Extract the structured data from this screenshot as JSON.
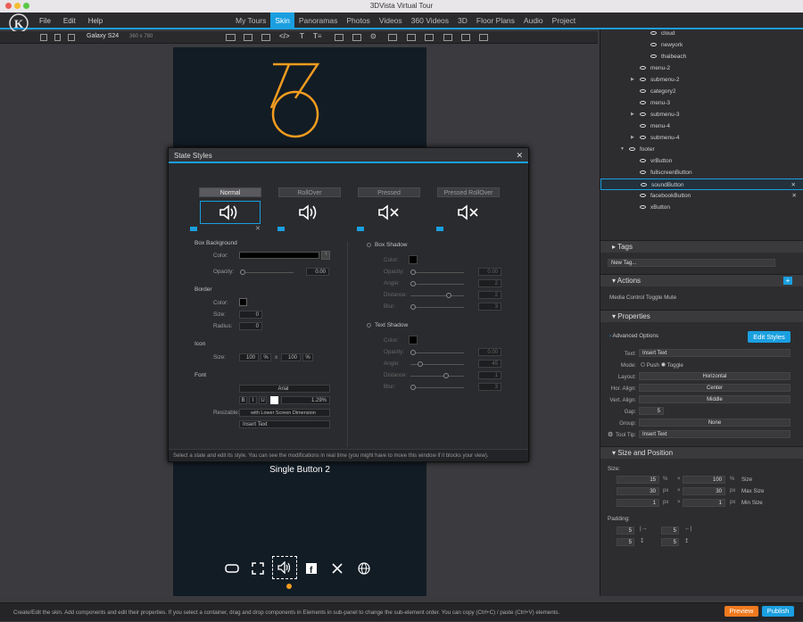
{
  "window": {
    "title": "3DVista Virtual Tour"
  },
  "menu": {
    "file": "File",
    "edit": "Edit",
    "help": "Help"
  },
  "tabs": [
    "My Tours",
    "Skin",
    "Panoramas",
    "Photos",
    "Videos",
    "360 Videos",
    "3D",
    "Floor Plans",
    "Audio",
    "Project"
  ],
  "toolbar": {
    "device": "Galaxy S24",
    "resolution": "360 x 780"
  },
  "phone": {
    "caption": "Single Button 2"
  },
  "dialog": {
    "title": "State Styles",
    "states": [
      "Normal",
      "RollOver",
      "Pressed",
      "Pressed RollOver"
    ],
    "box_background": {
      "heading": "Box Background",
      "color_label": "Color:",
      "opacity_label": "Opacity:",
      "opacity_value": "0.00"
    },
    "border": {
      "heading": "Border",
      "color_label": "Color:",
      "size_label": "Size:",
      "size_value": "0",
      "radius_label": "Radius:",
      "radius_value": "0"
    },
    "icon": {
      "heading": "Icon",
      "size_label": "Size:",
      "w": "100",
      "w_unit": "%",
      "x": "x",
      "h": "100",
      "h_unit": "%"
    },
    "font": {
      "heading": "Font",
      "family": "Arial",
      "bold": "B",
      "italic": "I",
      "underline": "U",
      "size": "1.29%",
      "resizable_label": "Resizable:",
      "resizable_value": "with Lower Screen Dimension",
      "sample": "Insert Text"
    },
    "box_shadow": {
      "heading": "Box Shadow",
      "color": "Color:",
      "opacity": "Opacity:",
      "opacity_v": "0.00",
      "angle": "Angle:",
      "angle_v": "2",
      "distance": "Distance:",
      "distance_v": "2",
      "blur": "Blur:",
      "blur_v": "3"
    },
    "text_shadow": {
      "heading": "Text Shadow",
      "color": "Color:",
      "opacity": "Opacity:",
      "opacity_v": "0.00",
      "angle": "Angle:",
      "angle_v": "45",
      "distance": "Distance:",
      "distance_v": "1",
      "blur": "Blur:",
      "blur_v": "3"
    },
    "footer": "Select a state and edit its style. You can see the modifications in real time (you might have to move this window if it blocks your view)."
  },
  "tree": [
    "cloud",
    "newyork",
    "thaibeach",
    "menu-2",
    "submenu-2",
    "category2",
    "menu-3",
    "submenu-3",
    "menu-4",
    "submenu-4",
    "footer",
    "vrButton",
    "fullscreenButton",
    "soundButton",
    "facebookButton",
    "xButton"
  ],
  "tags": {
    "heading": "Tags",
    "placeholder": "New Tag..."
  },
  "actions": {
    "heading": "Actions",
    "item": "Media Control Toggle Mute"
  },
  "properties": {
    "heading": "Properties",
    "advanced": "Advanced Options",
    "edit_styles": "Edit Styles",
    "text_label": "Text:",
    "text_value": "Insert Text",
    "mode_label": "Mode:",
    "mode_push": "Push",
    "mode_toggle": "Toggle",
    "layout_label": "Layout:",
    "layout_value": "Horizontal",
    "halign_label": "Hor. Align:",
    "halign_value": "Center",
    "valign_label": "Vert. Align:",
    "valign_value": "Middle",
    "gap_label": "Gap:",
    "gap_value": "5",
    "group_label": "Group:",
    "group_value": "None",
    "tooltip_label": "Tool Tip:",
    "tooltip_value": "Insert Text"
  },
  "size": {
    "heading": "Size and Position",
    "size_label": "Size:",
    "rows": [
      {
        "w": "15",
        "wu": "%",
        "h": "100",
        "hu": "%",
        "name": "Size"
      },
      {
        "w": "30",
        "wu": "px",
        "h": "30",
        "hu": "px",
        "name": "Max Size"
      },
      {
        "w": "1",
        "wu": "px",
        "h": "1",
        "hu": "px",
        "name": "Min Size"
      }
    ],
    "padding_label": "Padding:",
    "padding": [
      "5",
      "5",
      "5",
      "5"
    ]
  },
  "status": {
    "text": "Create/Edit the skin. Add components and edit their properties. If you select a container, drag and drop components in Elements in sub-panel to change the sub-element order. You can copy (Ctrl+C) / paste (Ctrl+V) elements.",
    "preview": "Preview",
    "publish": "Publish"
  },
  "colors": {
    "accent": "#1a9fe0",
    "logo": "#f39c1f",
    "preview": "#f07a1e"
  }
}
